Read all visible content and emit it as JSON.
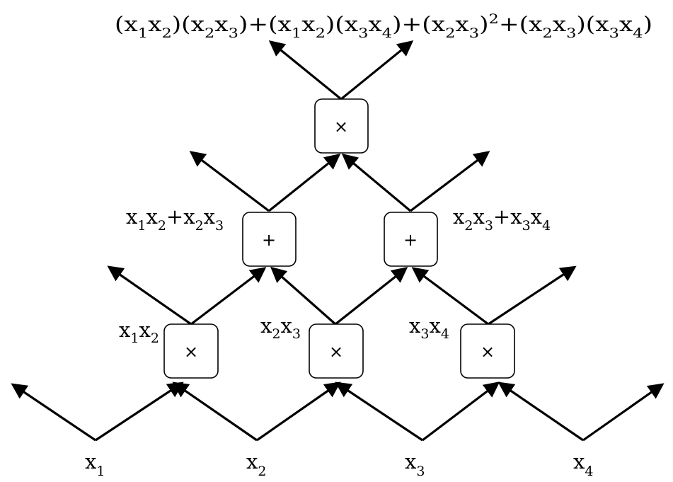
{
  "inputs": {
    "x1": {
      "base": "x",
      "sub": "1"
    },
    "x2": {
      "base": "x",
      "sub": "2"
    },
    "x3": {
      "base": "x",
      "sub": "3"
    },
    "x4": {
      "base": "x",
      "sub": "4"
    }
  },
  "operators": {
    "multiply": "×",
    "add": "+"
  },
  "products": {
    "x1x2": {
      "a": "x",
      "a_sub": "1",
      "b": "x",
      "b_sub": "2"
    },
    "x2x3": {
      "a": "x",
      "a_sub": "2",
      "b": "x",
      "b_sub": "3"
    },
    "x3x4": {
      "a": "x",
      "a_sub": "3",
      "b": "x",
      "b_sub": "4"
    }
  },
  "sums": {
    "left": "x1x2+x2x3",
    "right": "x2x3+x3x4"
  },
  "output": {
    "expression": "(x1x2)(x2x3)+(x1x2)(x3x4)+(x2x3)2+(x2x3)(x3x4)"
  },
  "colors": {
    "stroke": "#000000",
    "background": "#ffffff"
  }
}
